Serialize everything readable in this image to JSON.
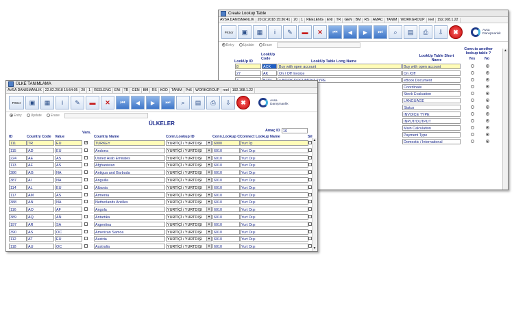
{
  "back_window": {
    "title": "Create Lookup Table",
    "status": [
      "AVSA DANISMANLIK",
      "20.02.2018 15:36:41",
      "20",
      "1",
      "REELENG",
      "ENI",
      "TR",
      "GEN",
      "BM",
      "RS",
      "AMAC",
      "TANIM",
      "WORKGROUP",
      "reel",
      "192.168.1.22"
    ],
    "toolbar": {
      "print_label": "PrtScr",
      "icons": [
        "save-icon",
        "grid-icon",
        "info-icon",
        "edit-icon",
        "remove-icon",
        "cancel-icon",
        "first-icon",
        "prev-icon",
        "next-icon",
        "last-icon",
        "search-icon",
        "calculator-icon",
        "print-icon",
        "export-icon",
        "exit-icon"
      ]
    },
    "logo": {
      "line1": "Avsa",
      "line2": "Danışmanlık"
    },
    "modes": [
      "Entry",
      "Update",
      "Erase"
    ],
    "headers": {
      "id": "LookUp ID",
      "code": "LookUp Code",
      "long": "LookUp Table Long Name",
      "short": "LookUp Table Short Name",
      "conn": "Conn.to another lookup table ?",
      "yes": "Yes",
      "no": "No"
    },
    "rows": [
      {
        "id": "8",
        "code": "ACK",
        "long": "Buy with open account",
        "short": "Buy with open account",
        "conn": "no"
      },
      {
        "id": "27",
        "code": "AK",
        "long": "On / Off Invoice",
        "short": "On /Off",
        "conn": "no"
      },
      {
        "id": "7",
        "code": "BTRI",
        "long": "e-BOOK DOCUMENT TYPE",
        "short": "eBook Document",
        "conn": "no"
      },
      {
        "id": "",
        "code": "",
        "long": "",
        "short": "Coordinate",
        "conn": "no"
      },
      {
        "id": "",
        "code": "",
        "long": "ETHOD",
        "short": "Stock Evaluation",
        "conn": "no"
      },
      {
        "id": "",
        "code": "",
        "long": "",
        "short": "LANGUAGE",
        "conn": "no"
      },
      {
        "id": "",
        "code": "",
        "long": "",
        "short": "Status",
        "conn": "no"
      },
      {
        "id": "",
        "code": "",
        "long": "",
        "short": "INVOICE TYPE",
        "conn": "no"
      },
      {
        "id": "",
        "code": "",
        "long": "",
        "short": "INPUT/OUTPUT",
        "conn": "no"
      },
      {
        "id": "",
        "code": "",
        "long": "ATION",
        "short": "Main Calculation",
        "conn": "no"
      },
      {
        "id": "",
        "code": "",
        "long": "",
        "short": "Payment Type",
        "conn": "no"
      },
      {
        "id": "",
        "code": "",
        "long": "",
        "short": "Domestic / International",
        "conn": "no"
      }
    ]
  },
  "front_window": {
    "title": "ÜLKE TANIMLAMA",
    "status": [
      "AVSA DANISMANLIK",
      "22.02.2018 15:54:05",
      "20",
      "1",
      "REELENG",
      "ENI",
      "TR",
      "GEN",
      "BM",
      "RS",
      "KOD",
      "TANIM",
      "Pri6",
      "WORKGROUP",
      "reel",
      "192.168.1.22"
    ],
    "toolbar": {
      "print_label": "PrtScr",
      "icons": [
        "save-icon",
        "grid-icon",
        "info-icon",
        "edit-icon",
        "remove-icon",
        "cancel-icon",
        "first-icon",
        "prev-icon",
        "next-icon",
        "last-icon",
        "search-icon",
        "calculator-icon",
        "print-icon",
        "export-icon",
        "exit-icon"
      ]
    },
    "logo": {
      "line1": "Avsa",
      "line2": "Danışmanlık"
    },
    "modes": [
      "Entry",
      "Update",
      "Erase"
    ],
    "heading": "ÜLKELER",
    "amac_label": "Amaç ID",
    "amac_value": "16",
    "headers": {
      "id": "ID",
      "code": "Country Code",
      "value": "Value",
      "vars": "Vars.",
      "name": "Country Name",
      "conn": "Conn.Lookup ID",
      "conn_code": "Conn.Lookup Code",
      "conn_name": "Connect Lookup Name",
      "sil": "Sil"
    },
    "rows": [
      {
        "id": "111",
        "code": "TR",
        "value": "EU",
        "vars": true,
        "name": "TURKEY",
        "conn": "YURTİÇİ / YURTDIŞI",
        "cc": "6000",
        "cn": "Yurt İçi"
      },
      {
        "id": "115",
        "code": "AD",
        "value": "EU",
        "vars": false,
        "name": "Andorra",
        "conn": "YURTİÇİ / YURTDIŞI",
        "cc": "6010",
        "cn": "Yurt Dışı"
      },
      {
        "id": "224",
        "code": "AE",
        "value": "AS",
        "vars": false,
        "name": "United Arab Emirates",
        "conn": "YURTİÇİ / YURTDIŞI",
        "cc": "6010",
        "cn": "Yurt Dışı"
      },
      {
        "id": "113",
        "code": "AF",
        "value": "AS",
        "vars": false,
        "name": "Afghanistan",
        "conn": "YURTİÇİ / YURTDIŞI",
        "cc": "6010",
        "cn": "Yurt Dışı"
      },
      {
        "id": "386",
        "code": "AG",
        "value": "NA",
        "vars": false,
        "name": "Antigua and Barbuda",
        "conn": "YURTİÇİ / YURTDIŞI",
        "cc": "6010",
        "cn": "Yurt Dışı"
      },
      {
        "id": "387",
        "code": "AI",
        "value": "NA",
        "vars": false,
        "name": "Anguilla",
        "conn": "YURTİÇİ / YURTDIŞI",
        "cc": "6010",
        "cn": "Yurt Dışı"
      },
      {
        "id": "114",
        "code": "AL",
        "value": "EU",
        "vars": false,
        "name": "Albania",
        "conn": "YURTİÇİ / YURTDIŞI",
        "cc": "6010",
        "cn": "Yurt Dışı"
      },
      {
        "id": "117",
        "code": "AM",
        "value": "AS",
        "vars": false,
        "name": "Armenia",
        "conn": "YURTİÇİ / YURTDIŞI",
        "cc": "6010",
        "cn": "Yurt Dışı"
      },
      {
        "id": "388",
        "code": "AN",
        "value": "NA",
        "vars": false,
        "name": "Netherlands Antilles",
        "conn": "YURTİÇİ / YURTDIŞI",
        "cc": "6010",
        "cn": "Yurt Dışı"
      },
      {
        "id": "116",
        "code": "AO",
        "value": "AF",
        "vars": false,
        "name": "Angola",
        "conn": "YURTİÇİ / YURTDIŞI",
        "cc": "6010",
        "cn": "Yurt Dışı"
      },
      {
        "id": "389",
        "code": "AQ",
        "value": "AN",
        "vars": false,
        "name": "Antartika",
        "conn": "YURTİÇİ / YURTDIŞI",
        "cc": "6010",
        "cn": "Yurt Dışı"
      },
      {
        "id": "197",
        "code": "AR",
        "value": "SA",
        "vars": false,
        "name": "Argentina",
        "conn": "YURTİÇİ / YURTDIŞI",
        "cc": "6010",
        "cn": "Yurt Dışı"
      },
      {
        "id": "390",
        "code": "AS",
        "value": "OC",
        "vars": false,
        "name": "American Samoa",
        "conn": "YURTİÇİ / YURTDIŞI",
        "cc": "6010",
        "cn": "Yurt Dışı"
      },
      {
        "id": "112",
        "code": "AT",
        "value": "EU",
        "vars": false,
        "name": "Austria",
        "conn": "YURTİÇİ / YURTDIŞI",
        "cc": "6010",
        "cn": "Yurt Dışı"
      },
      {
        "id": "118",
        "code": "AU",
        "value": "OC",
        "vars": false,
        "name": "Australia",
        "conn": "YURTİÇİ / YURTDIŞI",
        "cc": "6010",
        "cn": "Yurt Dışı"
      }
    ]
  },
  "colors": {
    "text_blue": "#1b2a8c",
    "highlight": "#fffcb8",
    "nav_blue": "#3e76c8",
    "exit_red": "#c20000"
  }
}
